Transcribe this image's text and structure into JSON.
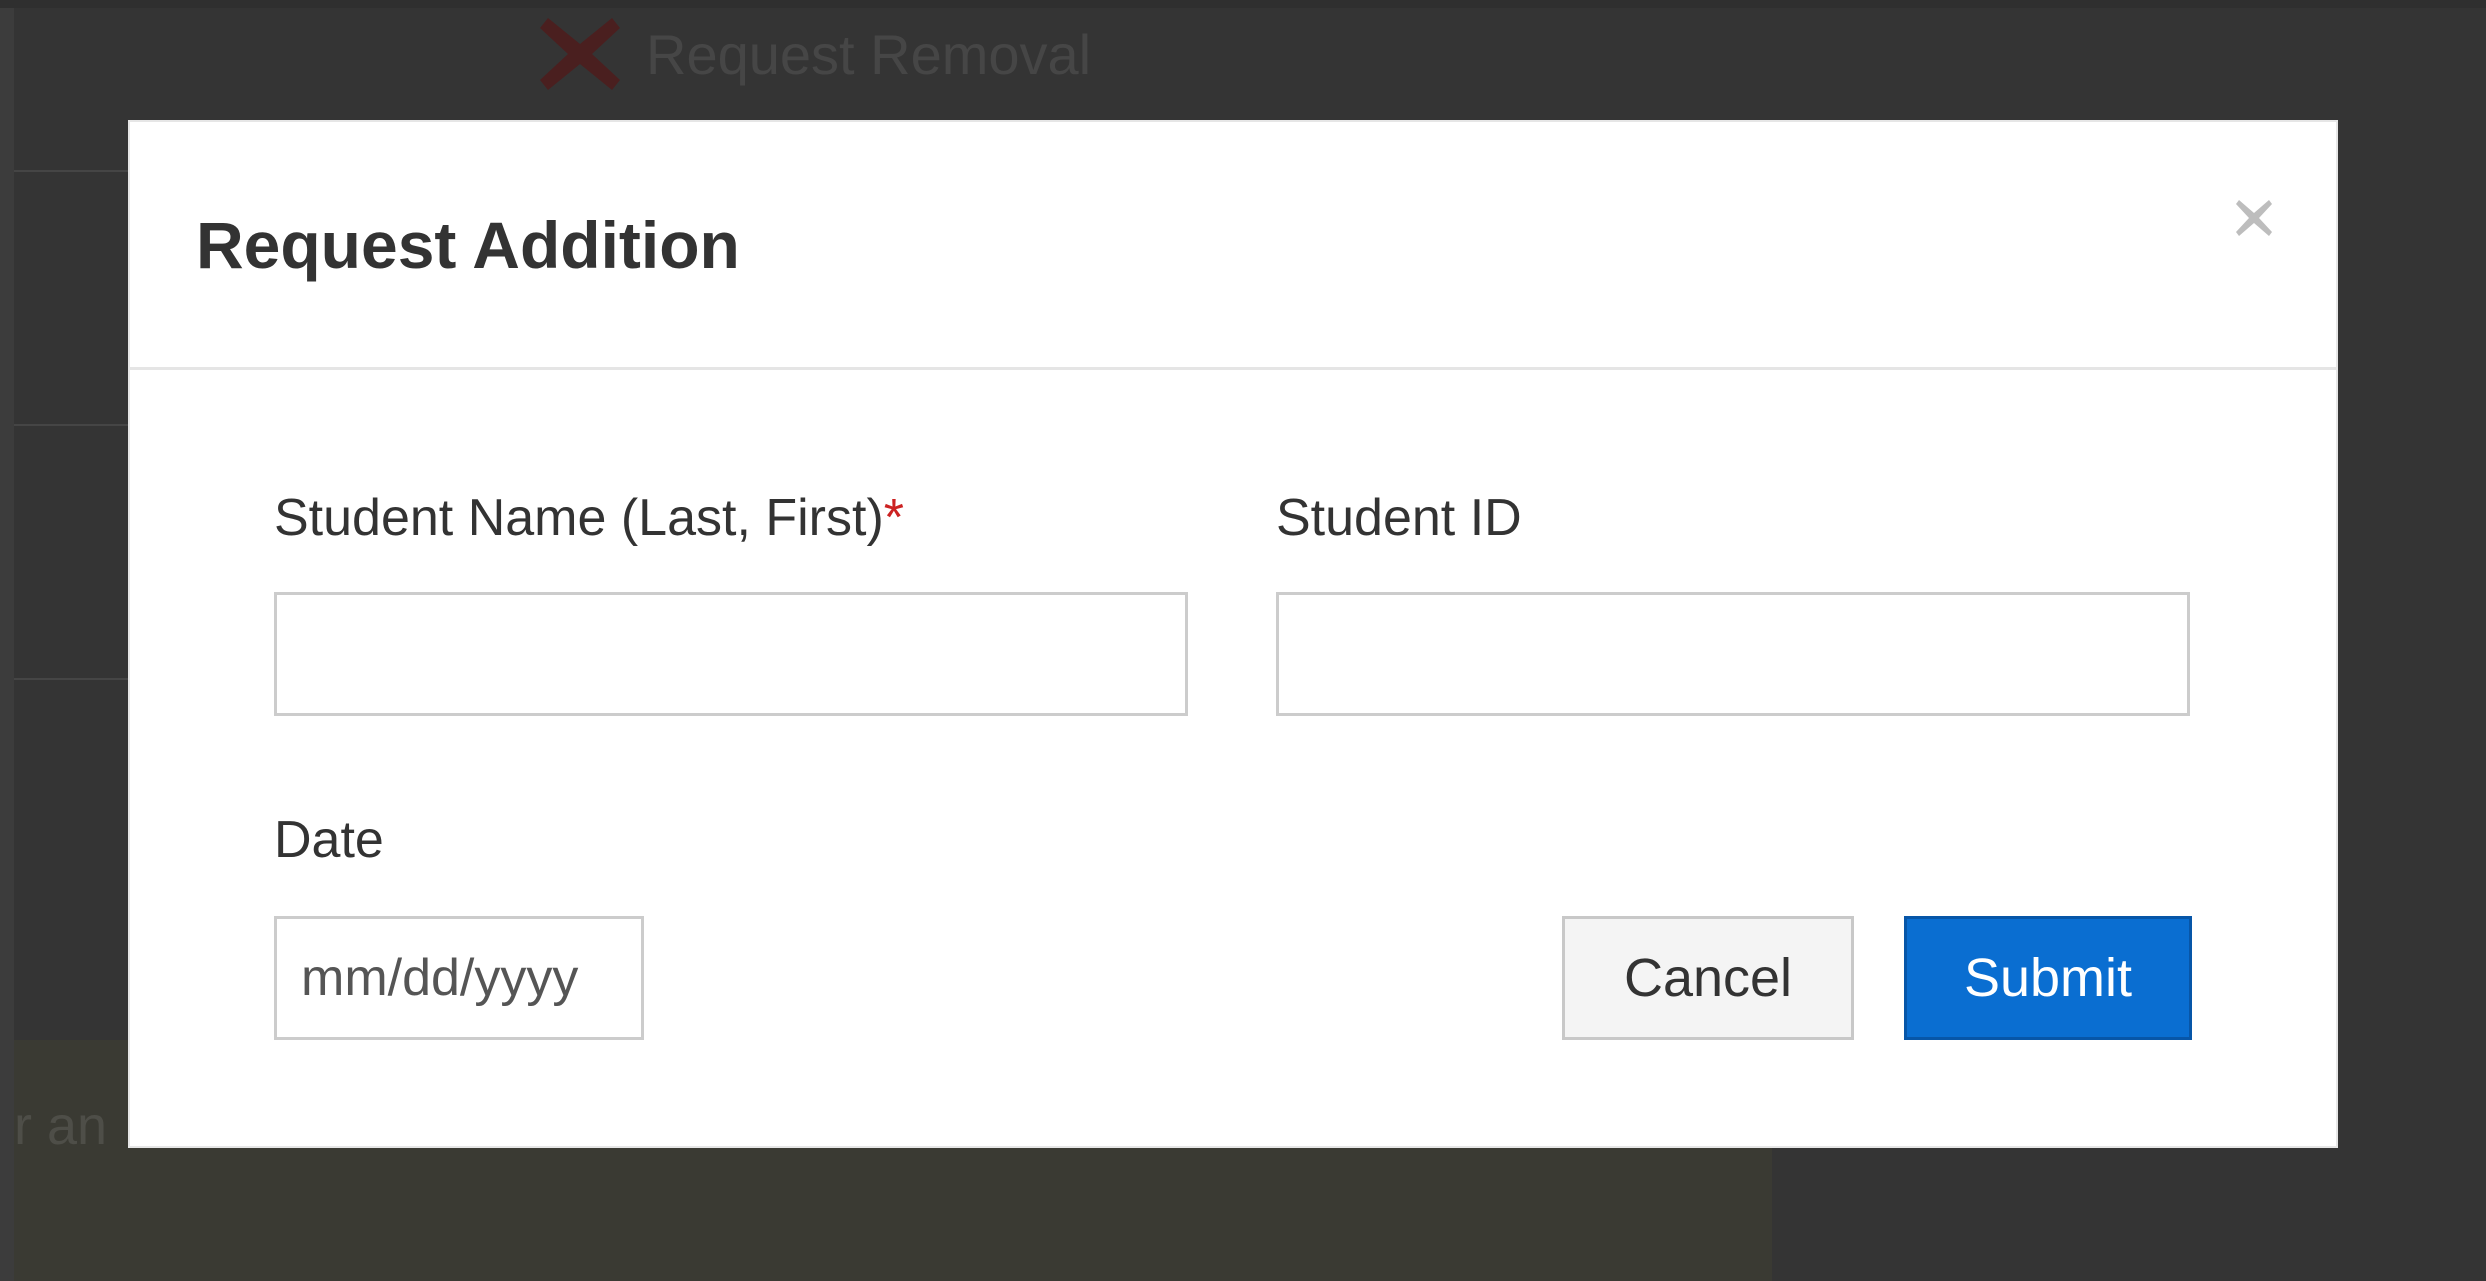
{
  "background": {
    "request_removal_label": "Request Removal",
    "request_removal_icon": "x-icon",
    "footer_fragment": "r an"
  },
  "modal": {
    "title": "Request Addition",
    "close_icon": "close-icon",
    "fields": {
      "student_name": {
        "label": "Student Name (Last, First)",
        "required_marker": "*",
        "value": "",
        "placeholder": ""
      },
      "student_id": {
        "label": "Student ID",
        "value": "",
        "placeholder": ""
      },
      "date": {
        "label": "Date",
        "value": "",
        "placeholder": "mm/dd/yyyy"
      }
    },
    "buttons": {
      "cancel": "Cancel",
      "submit": "Submit"
    }
  },
  "colors": {
    "overlay": "#333333",
    "submit_button": "#0a6ed1",
    "required_marker": "#cc2222",
    "removal_icon": "#4a1f1f"
  }
}
